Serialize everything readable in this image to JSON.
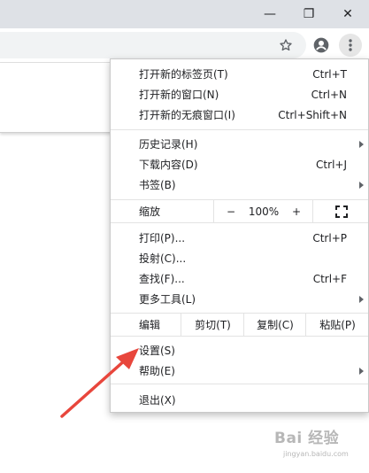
{
  "window": {
    "controls": [
      {
        "name": "minimize",
        "glyph": "—"
      },
      {
        "name": "restore",
        "glyph": "❐"
      },
      {
        "name": "close",
        "glyph": "✕"
      }
    ]
  },
  "toolbar": {
    "icons": [
      "star-icon",
      "profile-icon",
      "more-vert-icon"
    ]
  },
  "menu": {
    "new_tab": {
      "label": "打开新的标签页(T)",
      "shortcut": "Ctrl+T"
    },
    "new_window": {
      "label": "打开新的窗口(N)",
      "shortcut": "Ctrl+N"
    },
    "new_incognito": {
      "label": "打开新的无痕窗口(I)",
      "shortcut": "Ctrl+Shift+N"
    },
    "history": {
      "label": "历史记录(H)"
    },
    "downloads": {
      "label": "下载内容(D)",
      "shortcut": "Ctrl+J"
    },
    "bookmarks": {
      "label": "书签(B)"
    },
    "zoom": {
      "label": "缩放",
      "minus": "−",
      "value": "100%",
      "plus": "+"
    },
    "print": {
      "label": "打印(P)...",
      "shortcut": "Ctrl+P"
    },
    "cast": {
      "label": "投射(C)..."
    },
    "find": {
      "label": "查找(F)...",
      "shortcut": "Ctrl+F"
    },
    "more_tools": {
      "label": "更多工具(L)"
    },
    "edit": {
      "label": "编辑",
      "cut": "剪切(T)",
      "copy": "复制(C)",
      "paste": "粘贴(P)"
    },
    "settings": {
      "label": "设置(S)"
    },
    "help": {
      "label": "帮助(E)"
    },
    "exit": {
      "label": "退出(X)"
    }
  },
  "annotation": {
    "arrow_color": "#e8463c"
  },
  "watermark": {
    "main": "Bai 经验",
    "sub": "jingyan.baidu.com"
  }
}
